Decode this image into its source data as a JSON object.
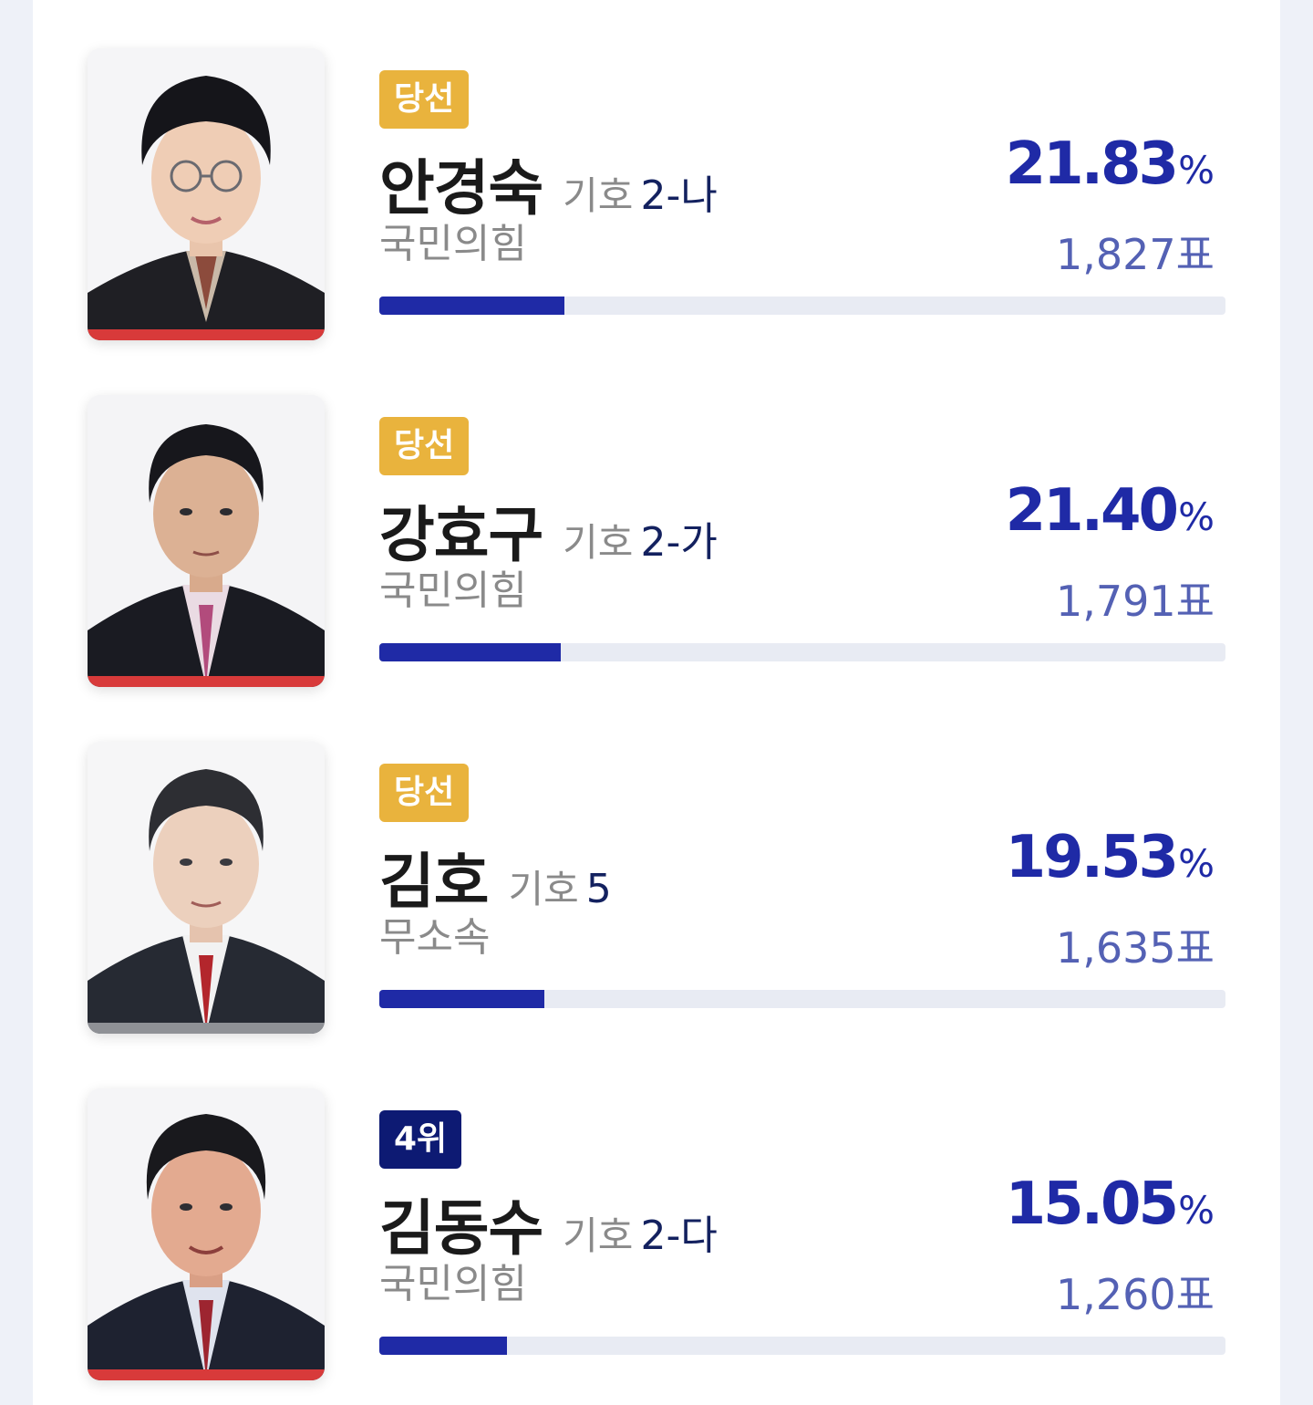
{
  "colors": {
    "accent": "#1f2aa6",
    "winner_badge": "#e9b33d",
    "rank_badge": "#0d1a73",
    "party_ppp": "#d83a3a",
    "party_independent": "#8f9196"
  },
  "candidates": [
    {
      "badge": "당선",
      "badge_type": "winner",
      "name": "안경숙",
      "number_label": "기호",
      "number": "2-나",
      "party": "국민의힘",
      "party_color": "#d83a3a",
      "percent": "21.83",
      "percent_unit": "%",
      "votes": "1,827표",
      "vote_share": 21.83,
      "portrait": "female-portrait"
    },
    {
      "badge": "당선",
      "badge_type": "winner",
      "name": "강효구",
      "number_label": "기호",
      "number": "2-가",
      "party": "국민의힘",
      "party_color": "#d83a3a",
      "percent": "21.40",
      "percent_unit": "%",
      "votes": "1,791표",
      "vote_share": 21.4,
      "portrait": "male-portrait"
    },
    {
      "badge": "당선",
      "badge_type": "winner",
      "name": "김호",
      "number_label": "기호",
      "number": "5",
      "party": "무소속",
      "party_color": "#8f9196",
      "percent": "19.53",
      "percent_unit": "%",
      "votes": "1,635표",
      "vote_share": 19.53,
      "portrait": "male-portrait"
    },
    {
      "badge": "4위",
      "badge_type": "rank",
      "name": "김동수",
      "number_label": "기호",
      "number": "2-다",
      "party": "국민의힘",
      "party_color": "#d83a3a",
      "percent": "15.05",
      "percent_unit": "%",
      "votes": "1,260표",
      "vote_share": 15.05,
      "portrait": "male-portrait"
    }
  ]
}
